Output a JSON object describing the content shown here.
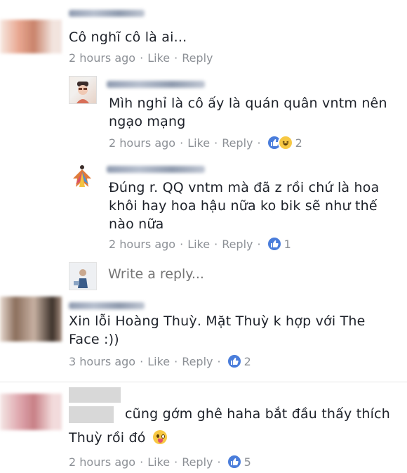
{
  "comments": [
    {
      "text": "Cô nghĩ cô là ai...",
      "time": "2 hours ago",
      "like": "Like",
      "reply": "Reply"
    },
    {
      "text": "Mìh nghỉ là cô ấy là quán quân vntm nên ngạo mạng",
      "time": "2 hours ago",
      "like": "Like",
      "reply": "Reply",
      "reaction_count": "2"
    },
    {
      "text": "Đúng r. QQ vntm mà đã z rồi chứ là hoa khôi hay hoa hậu nữa ko bik sẽ như thế nào nữa",
      "time": "2 hours ago",
      "like": "Like",
      "reply": "Reply",
      "reaction_count": "1"
    },
    {
      "text": "Xin lỗi Hoàng Thuỳ. Mặt Thuỳ k hợp với The Face :))",
      "time": "3 hours ago",
      "like": "Like",
      "reply": "Reply",
      "reaction_count": "2"
    },
    {
      "text_line1": "cũng gớm ghê haha bắt đầu thấy thích",
      "text_line2": "Thuỳ rồi đó",
      "time": "2 hours ago",
      "like": "Like",
      "reply": "Reply",
      "reaction_count": "5"
    }
  ],
  "reply_box": {
    "placeholder": "Write a reply..."
  },
  "colors": {
    "like_blue": "#4a7ddb",
    "haha_yellow": "#f7c843",
    "meta_grey": "#8c9096"
  }
}
